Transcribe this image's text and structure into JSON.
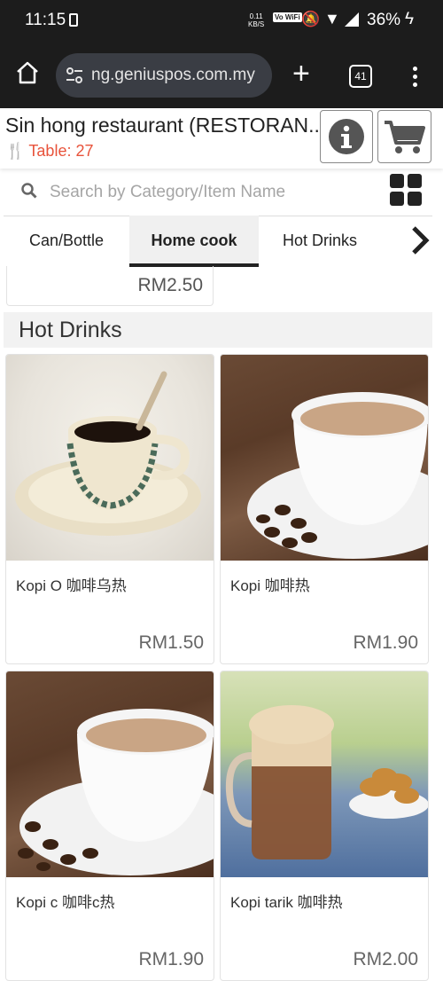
{
  "status_bar": {
    "time": "11:15",
    "net_speed": "0.11",
    "net_unit": "KB/S",
    "vowifi": "Vo WiFi",
    "battery": "36%"
  },
  "browser": {
    "url": "ng.geniuspos.com.my",
    "tab_count": "41"
  },
  "header": {
    "restaurant_name": "Sin hong restaurant (RESTORAN...",
    "table_label": "Table: 27"
  },
  "search": {
    "placeholder": "Search by Category/Item Name"
  },
  "categories": {
    "tabs": [
      {
        "label": "Can/Bottle"
      },
      {
        "label": "Home cook"
      },
      {
        "label": "Hot Drinks"
      }
    ],
    "active": "Home cook"
  },
  "previous_item": {
    "price": "RM2.50"
  },
  "section": {
    "title": "Hot Drinks",
    "items": [
      {
        "name": "Kopi O 咖啡乌热",
        "price": "RM1.50"
      },
      {
        "name": "Kopi 咖啡热",
        "price": "RM1.90"
      },
      {
        "name": "Kopi c 咖啡c热",
        "price": "RM1.90"
      },
      {
        "name": "Kopi tarik 咖啡热",
        "price": "RM2.00"
      }
    ]
  },
  "colors": {
    "accent": "#e8533b",
    "status_bg": "#1c1c1c",
    "url_bg": "#3a3d44"
  }
}
